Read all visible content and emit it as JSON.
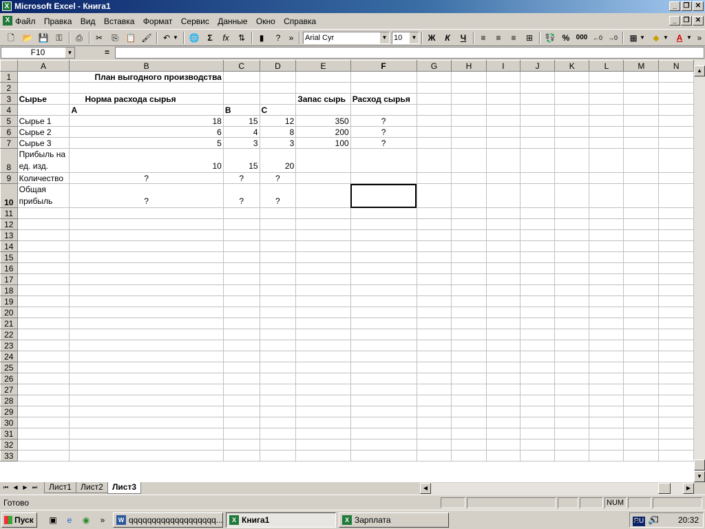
{
  "window": {
    "title": "Microsoft Excel - Книга1"
  },
  "menu": [
    "Файл",
    "Правка",
    "Вид",
    "Вставка",
    "Формат",
    "Сервис",
    "Данные",
    "Окно",
    "Справка"
  ],
  "toolbar": {
    "font": "Arial Cyr",
    "size": "10",
    "bold": "Ж",
    "italic": "К",
    "underline": "Ч",
    "percent": "%",
    "thousands": "000",
    "sum": "Σ",
    "fx": "fx"
  },
  "formula_bar": {
    "name_box": "F10",
    "equals": "=",
    "formula": ""
  },
  "grid": {
    "columns": [
      "A",
      "B",
      "C",
      "D",
      "E",
      "F",
      "G",
      "H",
      "I",
      "J",
      "K",
      "L",
      "M",
      "N"
    ],
    "active_cell": "F10",
    "cells": {
      "B1": "План выгодного производства",
      "A3": "Сырье",
      "B3": "Норма расхода сырья",
      "E3": "Запас сырь",
      "F3": "Расход сырья",
      "B4": "A",
      "C4": "B",
      "D4": "C",
      "A5": "Сырье 1",
      "B5": "18",
      "C5": "15",
      "D5": "12",
      "E5": "350",
      "F5": "?",
      "A6": "Сырье 2",
      "B6": "6",
      "C6": "4",
      "D6": "8",
      "E6": "200",
      "F6": "?",
      "A7": "Сырье 3",
      "B7": "5",
      "C7": "3",
      "D7": "3",
      "E7": "100",
      "F7": "?",
      "A8a": "Прибыль на",
      "A8b": "ед. изд.",
      "B8": "10",
      "C8": "15",
      "D8": "20",
      "A9": "Количество",
      "B9": "?",
      "C9": "?",
      "D9": "?",
      "A10a": "Общая",
      "A10b": "прибыль",
      "B10": "?",
      "C10": "?",
      "D10": "?"
    }
  },
  "sheet_tabs": [
    "Лист1",
    "Лист2",
    "Лист3"
  ],
  "active_sheet": "Лист3",
  "status": {
    "text": "Готово",
    "num": "NUM"
  },
  "taskbar": {
    "start": "Пуск",
    "tasks": [
      "qqqqqqqqqqqqqqqqqqq...",
      "Книга1",
      "Зарплата"
    ],
    "lang": "RU",
    "clock": "20:32"
  }
}
